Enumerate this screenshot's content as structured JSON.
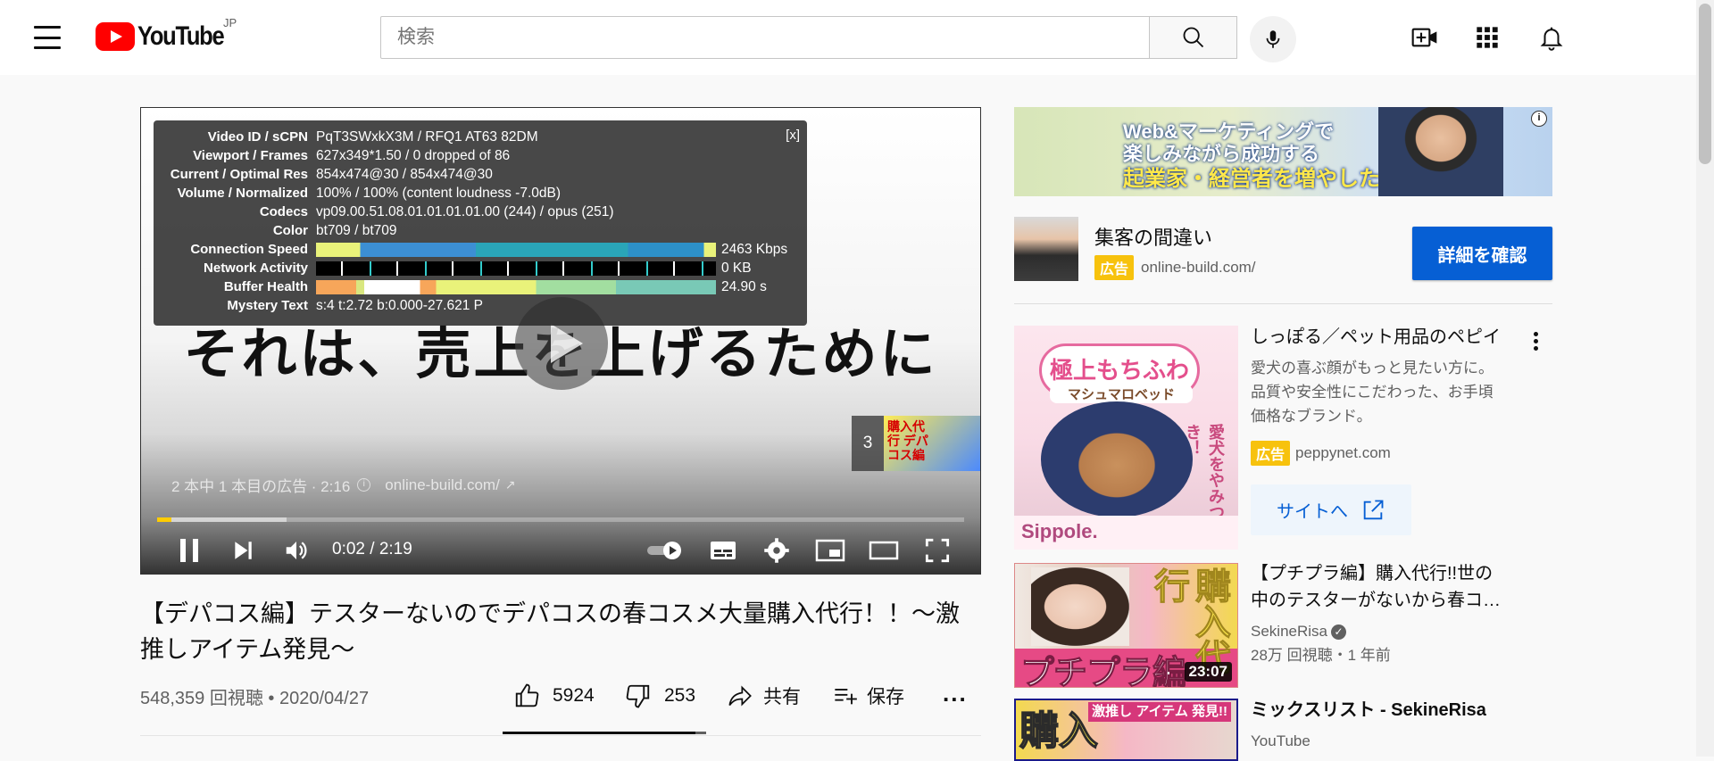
{
  "header": {
    "logo_text": "YouTube",
    "region": "JP",
    "search_placeholder": "検索"
  },
  "player": {
    "subtitle": "それは、売上を上げるために",
    "stats": {
      "close_label": "[x]",
      "rows": [
        {
          "k": "Video ID / sCPN",
          "v": "PqT3SWxkX3M / RFQ1 AT63 82DM"
        },
        {
          "k": "Viewport / Frames",
          "v": "627x349*1.50 / 0 dropped of 86"
        },
        {
          "k": "Current / Optimal Res",
          "v": "854x474@30 / 854x474@30"
        },
        {
          "k": "Volume / Normalized",
          "v": "100% / 100% (content loudness -7.0dB)"
        },
        {
          "k": "Codecs",
          "v": "vp09.00.51.08.01.01.01.01.00 (244) / opus (251)"
        },
        {
          "k": "Color",
          "v": "bt709 / bt709"
        },
        {
          "k": "Connection Speed",
          "v": "2463 Kbps"
        },
        {
          "k": "Network Activity",
          "v": "0 KB"
        },
        {
          "k": "Buffer Health",
          "v": "24.90 s"
        },
        {
          "k": "Mystery Text",
          "v": "s:4 t:2.72 b:0.000-27.621 P"
        }
      ]
    },
    "ad_info_text": "2 本中 1 本目の広告 · 2:16",
    "ad_domain": "online-build.com/",
    "ad_thumb_count": "3",
    "ad_thumb_text": "購入代行 デパコス編",
    "progress_played": 0.018,
    "progress_buffered": 0.16,
    "time_display": "0:02 / 2:19",
    "accent_color": "#ffcc00"
  },
  "video": {
    "title": "【デパコス編】テスターないのでデパコスの春コスメ大量購入代行！！〜激推しアイテム発見〜",
    "views": "548,359 回視聴 • 2020/04/27",
    "like_count": "5924",
    "dislike_count": "253",
    "share_label": "共有",
    "save_label": "保存",
    "more_label": "..."
  },
  "sidebar": {
    "banner_ad": {
      "line1": "Web&マーケティングで",
      "line2": "楽しみながら成功する",
      "line3": "起業家・経営者を増やしたい！",
      "info_icon": "i"
    },
    "ad_card": {
      "headline": "集客の間違い",
      "badge": "広告",
      "url": "online-build.com/",
      "cta": "詳細を確認"
    },
    "promo": {
      "thumb_chip": "極上もちふわ",
      "thumb_sub": "マシュマロベッド",
      "thumb_brand": "Sippole.",
      "thumb_vertical": "愛犬をやみつき！",
      "title": "しっぽる／ペット用品のペピイ",
      "description": [
        "愛犬の喜ぶ顔がもっと見たい方に。",
        "品質や安全性にこだわった、お手頃",
        "価格なブランド。"
      ],
      "badge": "広告",
      "url": "peppynet.com",
      "button": "サイトへ"
    },
    "video1": {
      "thumb_big": "プチプラ編",
      "thumb_side": "購入代行",
      "duration": "23:07",
      "title_line1": "【プチプラ編】購入代行!!世の",
      "title_line2": "中のテスターがないから春コ…",
      "channel": "SekineRisa",
      "meta": "28万 回視聴・1 年前"
    },
    "mix": {
      "thumb_big": "購入",
      "thumb_badge": "激推し アイテム 発見!!",
      "title": "ミックスリスト - SekineRisa",
      "channel": "YouTube"
    }
  }
}
